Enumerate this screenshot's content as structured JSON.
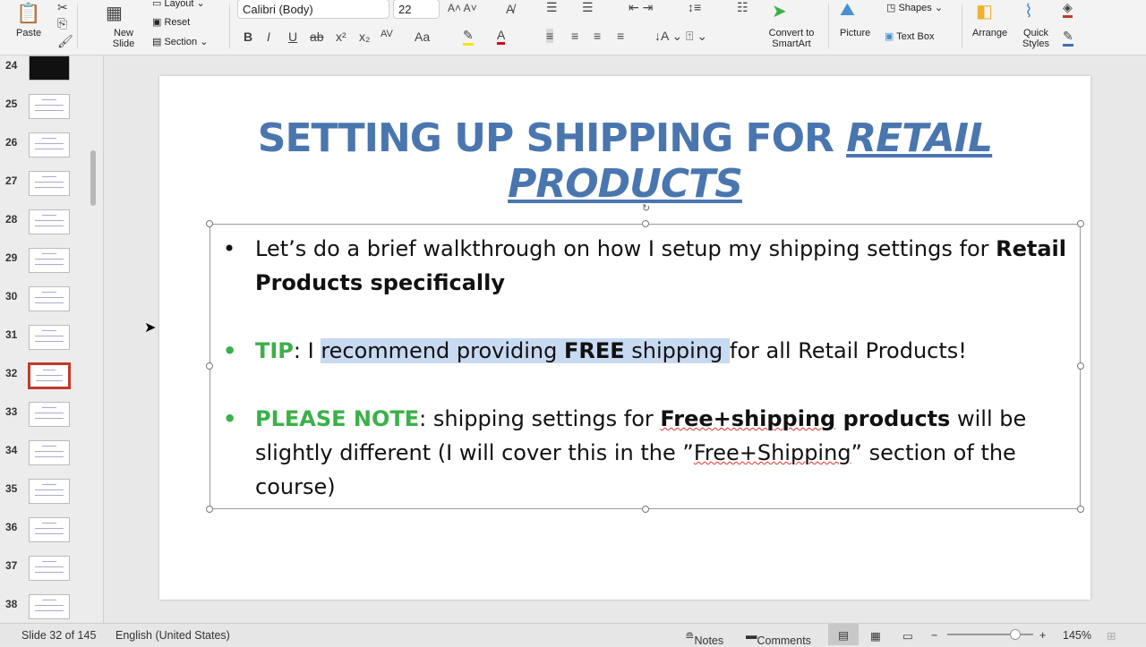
{
  "ribbon": {
    "paste": "Paste",
    "new_slide": "New Slide",
    "layout": "Layout",
    "reset": "Reset",
    "section": "Section",
    "font_name": "Calibri (Body)",
    "font_size": "22",
    "convert_smartart": "Convert to SmartArt",
    "picture": "Picture",
    "shapes": "Shapes",
    "text_box": "Text Box",
    "arrange": "Arrange",
    "quick_styles": "Quick Styles",
    "format_buttons": [
      "B",
      "I",
      "U",
      "ab",
      "x²",
      "x₂",
      "AV",
      "Aa"
    ]
  },
  "sidebar": {
    "slides": [
      {
        "n": "24"
      },
      {
        "n": "25"
      },
      {
        "n": "26"
      },
      {
        "n": "27"
      },
      {
        "n": "28"
      },
      {
        "n": "29"
      },
      {
        "n": "30"
      },
      {
        "n": "31"
      },
      {
        "n": "32",
        "selected": true
      },
      {
        "n": "33"
      },
      {
        "n": "34"
      },
      {
        "n": "35"
      },
      {
        "n": "36"
      },
      {
        "n": "37"
      },
      {
        "n": "38"
      }
    ]
  },
  "slide": {
    "title_plain": "SETTING UP SHIPPING FOR ",
    "title_italic": "RETAIL PRODUCTS",
    "bullet1_a": "Let’s do a brief walkthrough on how I setup my shipping settings for ",
    "bullet1_b": "Retail Products specifically",
    "bullet2_label": "TIP",
    "bullet2_a": ": I ",
    "bullet2_hl1": "recommend providing ",
    "bullet2_hl2": "FREE",
    "bullet2_hl3": " shipping ",
    "bullet2_b": "for all Retail Products!",
    "bullet3_label": "PLEASE NOTE",
    "bullet3_a": ": shipping settings for ",
    "bullet3_b1": "Free+shipping",
    "bullet3_b2": " products",
    "bullet3_c": " will be slightly different (I will cover this in the ”",
    "bullet3_d": "Free+Shipping",
    "bullet3_e": "” section of the course)",
    "colors": {
      "title": "#4a76b0",
      "label": "#3cb04a",
      "highlight": "#c8daf2"
    }
  },
  "status": {
    "slide": "Slide 32 of 145",
    "language": "English (United States)",
    "notes": "Notes",
    "comments": "Comments",
    "zoom": "145%",
    "zoom_level": 145
  }
}
